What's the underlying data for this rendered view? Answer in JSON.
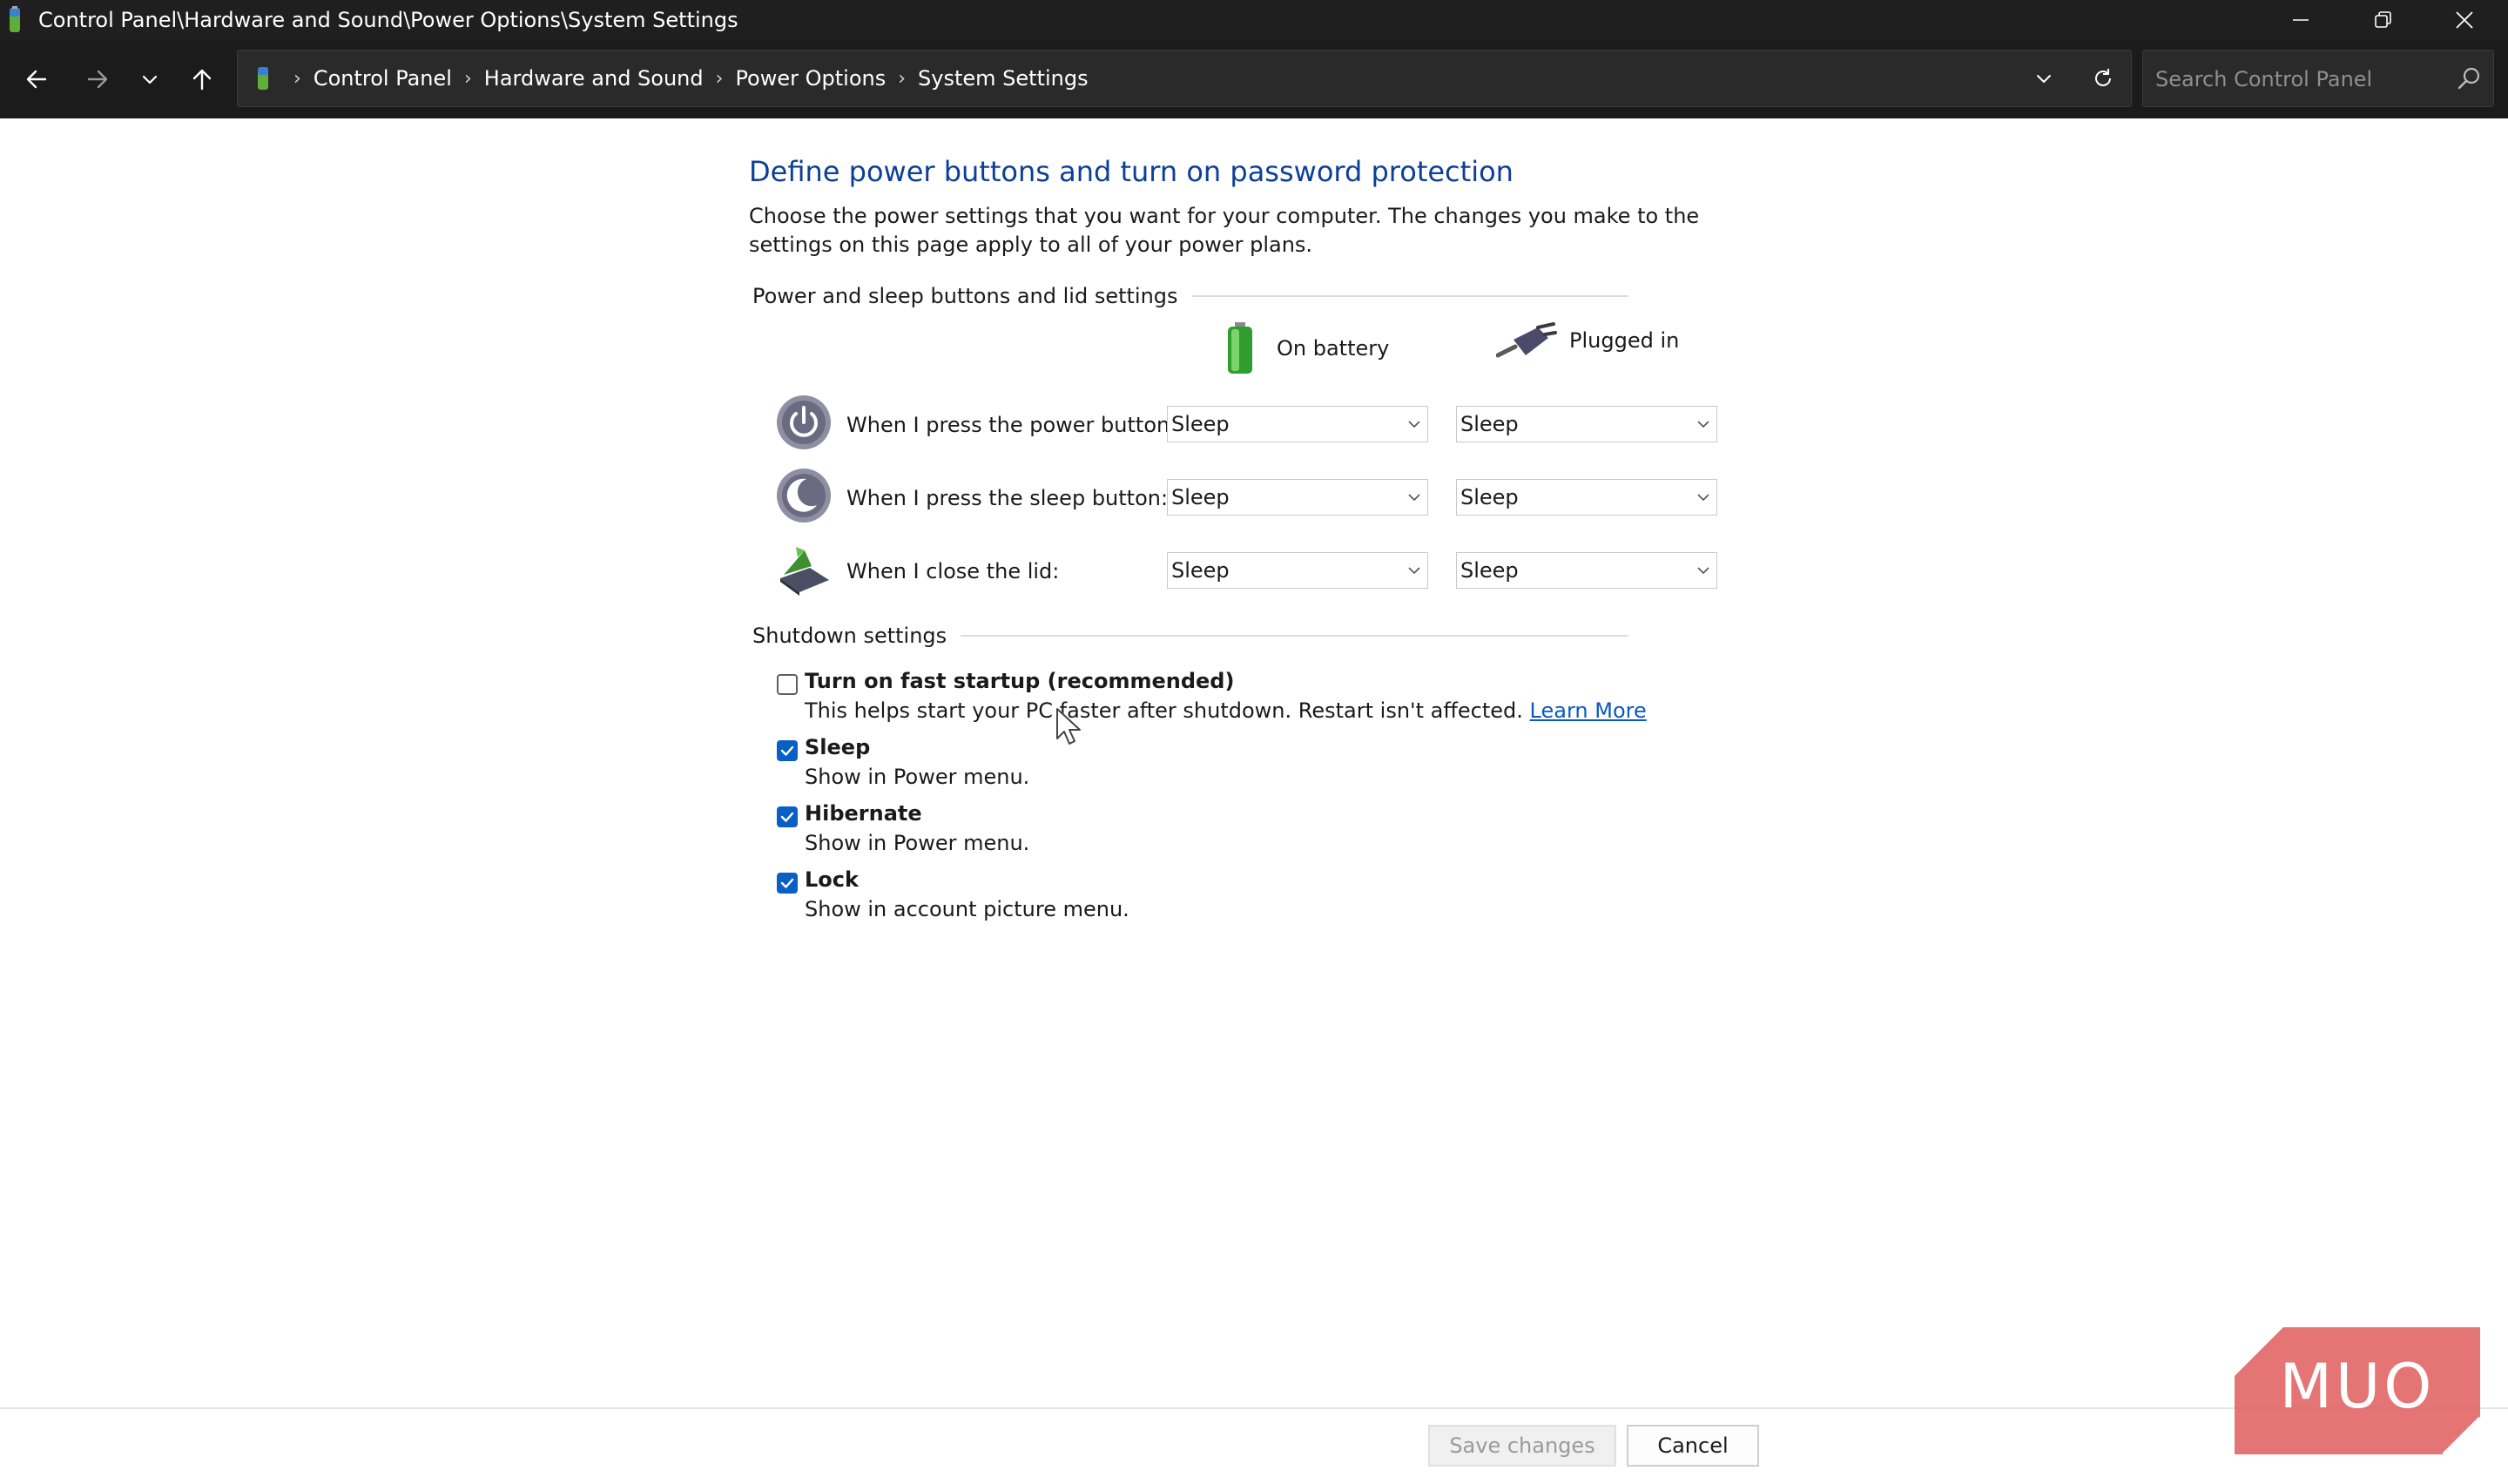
{
  "window": {
    "title": "Control Panel\\Hardware and Sound\\Power Options\\System Settings",
    "controls": [
      "minimize",
      "restore",
      "close"
    ]
  },
  "address_bar": {
    "crumbs": [
      "Control Panel",
      "Hardware and Sound",
      "Power Options",
      "System Settings"
    ],
    "search_placeholder": "Search Control Panel"
  },
  "page": {
    "title": "Define power buttons and turn on password protection",
    "intro": "Choose the power settings that you want for your computer. The changes you make to the settings on this page apply to all of your power plans."
  },
  "power_section": {
    "title": "Power and sleep buttons and lid settings",
    "columns": [
      "On battery",
      "Plugged in"
    ],
    "rows": [
      {
        "label": "When I press the power button:",
        "on_battery": "Sleep",
        "plugged_in": "Sleep",
        "icon": "power-button-icon"
      },
      {
        "label": "When I press the sleep button:",
        "on_battery": "Sleep",
        "plugged_in": "Sleep",
        "icon": "sleep-button-icon"
      },
      {
        "label": "When I close the lid:",
        "on_battery": "Sleep",
        "plugged_in": "Sleep",
        "icon": "laptop-lid-icon"
      }
    ]
  },
  "shutdown_section": {
    "title": "Shutdown settings",
    "options": [
      {
        "label": "Turn on fast startup (recommended)",
        "description": "This helps start your PC faster after shutdown. Restart isn't affected.",
        "link": "Learn More",
        "checked": false
      },
      {
        "label": "Sleep",
        "description": "Show in Power menu.",
        "checked": true
      },
      {
        "label": "Hibernate",
        "description": "Show in Power menu.",
        "checked": true
      },
      {
        "label": "Lock",
        "description": "Show in account picture menu.",
        "checked": true
      }
    ]
  },
  "footer": {
    "save_label": "Save changes",
    "cancel_label": "Cancel"
  },
  "watermark": {
    "text": "MUO"
  },
  "colors": {
    "titlebar": "#1f1f1f",
    "heading": "#0c3f96",
    "checkbox": "#0a5fc4",
    "link": "#0a58c2",
    "watermark": "#e15d5d"
  }
}
